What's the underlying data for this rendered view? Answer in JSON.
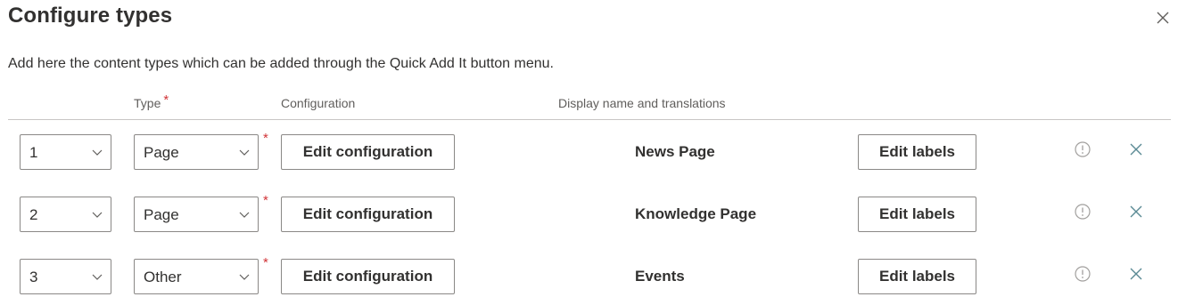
{
  "dialog": {
    "title": "Configure types",
    "description": "Add here the content types which can be added through the Quick Add It button menu."
  },
  "columns": {
    "type": "Type",
    "required_mark": "*",
    "configuration": "Configuration",
    "display_name": "Display name and translations"
  },
  "rows": [
    {
      "order": "1",
      "type": "Page",
      "config_button": "Edit configuration",
      "display_name": "News Page",
      "labels_button": "Edit labels"
    },
    {
      "order": "2",
      "type": "Page",
      "config_button": "Edit configuration",
      "display_name": "Knowledge Page",
      "labels_button": "Edit labels"
    },
    {
      "order": "3",
      "type": "Other",
      "config_button": "Edit configuration",
      "display_name": "Events",
      "labels_button": "Edit labels"
    }
  ],
  "icons": {
    "close": "close-icon",
    "chevron": "chevron-down-icon",
    "info": "info-icon",
    "delete": "delete-x-icon"
  },
  "colors": {
    "required": "#d13438",
    "delete_icon": "#5a8a94",
    "info_icon": "#a19f9d",
    "border": "#8a8886"
  }
}
